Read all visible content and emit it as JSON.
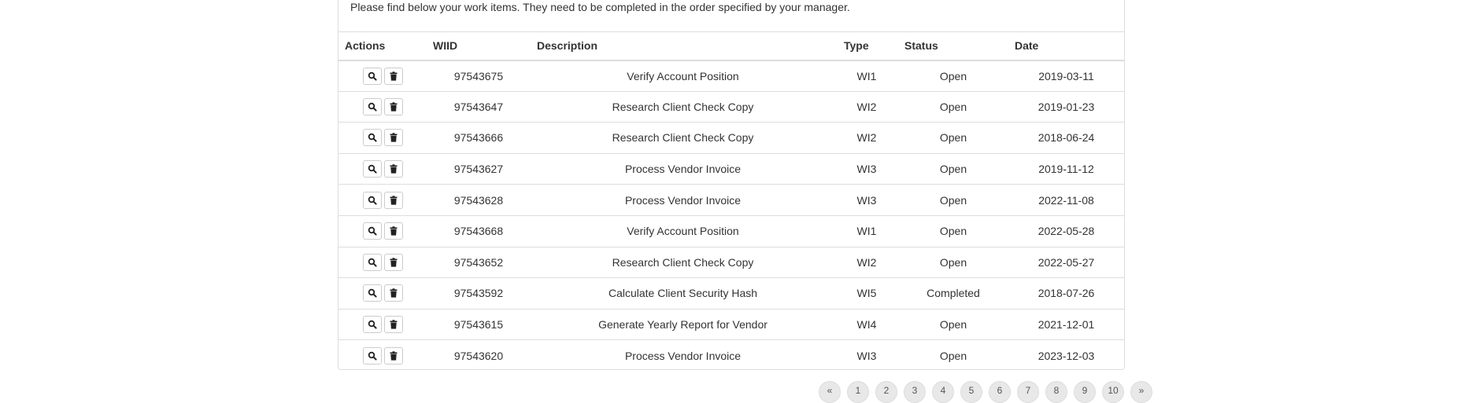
{
  "intro_text": "Please find below your work items. They need to be completed in the order specified by your manager.",
  "table": {
    "columns": [
      "Actions",
      "WIID",
      "Description",
      "Type",
      "Status",
      "Date"
    ],
    "rows": [
      {
        "wiid": "97543675",
        "description": "Verify Account Position",
        "type": "WI1",
        "status": "Open",
        "date": "2019-03-11"
      },
      {
        "wiid": "97543647",
        "description": "Research Client Check Copy",
        "type": "WI2",
        "status": "Open",
        "date": "2019-01-23"
      },
      {
        "wiid": "97543666",
        "description": "Research Client Check Copy",
        "type": "WI2",
        "status": "Open",
        "date": "2018-06-24"
      },
      {
        "wiid": "97543627",
        "description": "Process Vendor Invoice",
        "type": "WI3",
        "status": "Open",
        "date": "2019-11-12"
      },
      {
        "wiid": "97543628",
        "description": "Process Vendor Invoice",
        "type": "WI3",
        "status": "Open",
        "date": "2022-11-08"
      },
      {
        "wiid": "97543668",
        "description": "Verify Account Position",
        "type": "WI1",
        "status": "Open",
        "date": "2022-05-28"
      },
      {
        "wiid": "97543652",
        "description": "Research Client Check Copy",
        "type": "WI2",
        "status": "Open",
        "date": "2022-05-27"
      },
      {
        "wiid": "97543592",
        "description": "Calculate Client Security Hash",
        "type": "WI5",
        "status": "Completed",
        "date": "2018-07-26"
      },
      {
        "wiid": "97543615",
        "description": "Generate Yearly Report for Vendor",
        "type": "WI4",
        "status": "Open",
        "date": "2021-12-01"
      },
      {
        "wiid": "97543620",
        "description": "Process Vendor Invoice",
        "type": "WI3",
        "status": "Open",
        "date": "2023-12-03"
      }
    ]
  },
  "action_icons": {
    "view": "search-icon",
    "delete": "trash-icon"
  },
  "pagination": {
    "items": [
      "«",
      "1",
      "2",
      "3",
      "4",
      "5",
      "6",
      "7",
      "8",
      "9",
      "10",
      "»"
    ]
  }
}
